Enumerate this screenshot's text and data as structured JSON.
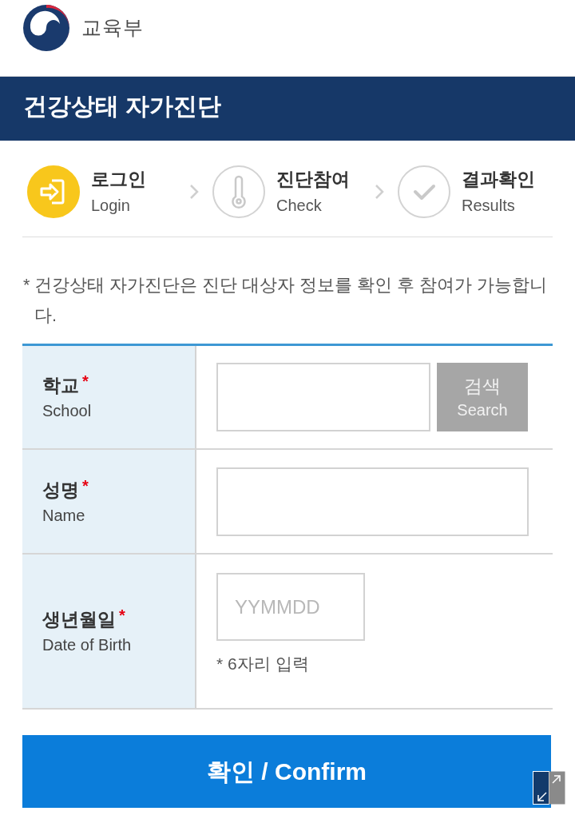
{
  "header": {
    "ministry": "교육부"
  },
  "title_bar": {
    "title": "건강상태 자가진단"
  },
  "steps": [
    {
      "kind": "login",
      "label": "로그인",
      "sublabel": "Login",
      "active": true
    },
    {
      "kind": "check",
      "label": "진단참여",
      "sublabel": "Check",
      "active": false
    },
    {
      "kind": "results",
      "label": "결과확인",
      "sublabel": "Results",
      "active": false
    }
  ],
  "notice": "* 건강상태 자가진단은 진단 대상자 정보를 확인 후 참여가 가능합니다.",
  "form": {
    "rows": [
      {
        "kind": "search",
        "label": "학교",
        "sublabel": "School",
        "required_mark": "*",
        "search_button": {
          "label": "검색",
          "sublabel": "Search"
        }
      },
      {
        "kind": "text",
        "label": "성명",
        "sublabel": "Name",
        "required_mark": "*"
      },
      {
        "kind": "date",
        "label": "생년월일",
        "sublabel": "Date of Birth",
        "required_mark": "*",
        "placeholder": "YYMMDD",
        "hint": "* 6자리 입력"
      }
    ]
  },
  "confirm_button": {
    "label": "확인 / Confirm"
  }
}
